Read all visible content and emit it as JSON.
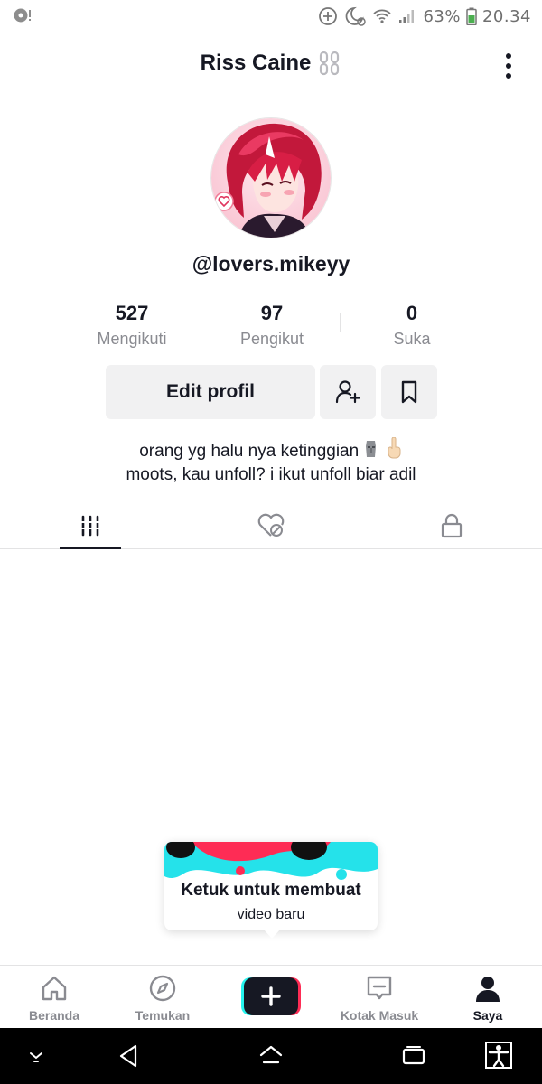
{
  "status_bar": {
    "battery_percent": "63%",
    "time": "20.34"
  },
  "header": {
    "title": "Riss Caine"
  },
  "profile": {
    "username": "@lovers.mikeyy",
    "stats": [
      {
        "value": "527",
        "label": "Mengikuti"
      },
      {
        "value": "97",
        "label": "Pengikut"
      },
      {
        "value": "0",
        "label": "Suka"
      }
    ],
    "edit_button": "Edit profil",
    "bio_line1": "orang yg halu nya ketinggian",
    "bio_line2": "moots, kau unfoll? i ikut unfoll biar adil"
  },
  "tooltip": {
    "line1": "Ketuk untuk membuat",
    "line2": "video baru"
  },
  "bottom_nav": {
    "items": [
      {
        "label": "Beranda",
        "icon": "home-icon"
      },
      {
        "label": "Temukan",
        "icon": "compass-icon"
      },
      {
        "label": "Kotak Masuk",
        "icon": "inbox-icon"
      },
      {
        "label": "Saya",
        "icon": "profile-icon"
      }
    ]
  },
  "colors": {
    "text": "#161823",
    "muted": "#8a8b91",
    "button_bg": "#f1f1f2",
    "accent_red": "#fe2c55",
    "accent_cyan": "#25f4ee"
  }
}
